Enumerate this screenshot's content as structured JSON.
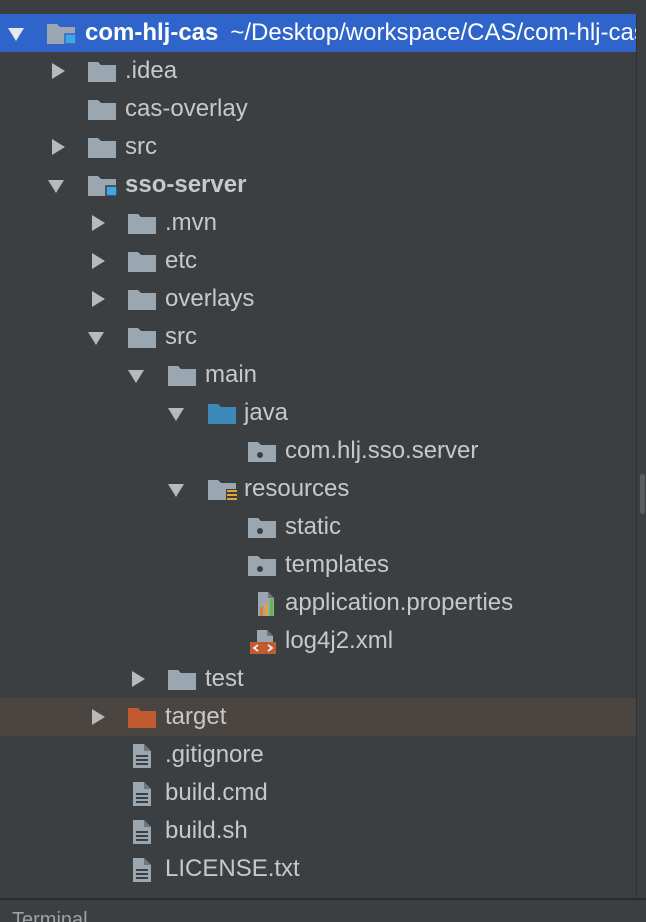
{
  "project_tree": {
    "root": {
      "name": "com-hlj-cas",
      "path": "~/Desktop/workspace/CAS/com-hlj-cas"
    },
    "items": {
      "idea": ".idea",
      "cas_overlay": "cas-overlay",
      "src": "src",
      "sso_server": "sso-server",
      "mvn": ".mvn",
      "etc": "etc",
      "overlays": "overlays",
      "sso_src": "src",
      "main": "main",
      "java": "java",
      "package": "com.hlj.sso.server",
      "resources": "resources",
      "static": "static",
      "templates": "templates",
      "app_props": "application.properties",
      "log4j2": "log4j2.xml",
      "test": "test",
      "target": "target",
      "gitignore": ".gitignore",
      "build_cmd": "build.cmd",
      "build_sh": "build.sh",
      "license": "LICENSE.txt"
    }
  },
  "bottom_bar": {
    "terminal": "Terminal"
  },
  "colors": {
    "background": "#3c3f41",
    "selection": "#2f65ca",
    "highlight": "#4a4541",
    "folder": "#9aa7b0",
    "source_folder": "#3d8ab8",
    "excluded_folder": "#c05a30",
    "module_badge": "#3fa7e6"
  }
}
